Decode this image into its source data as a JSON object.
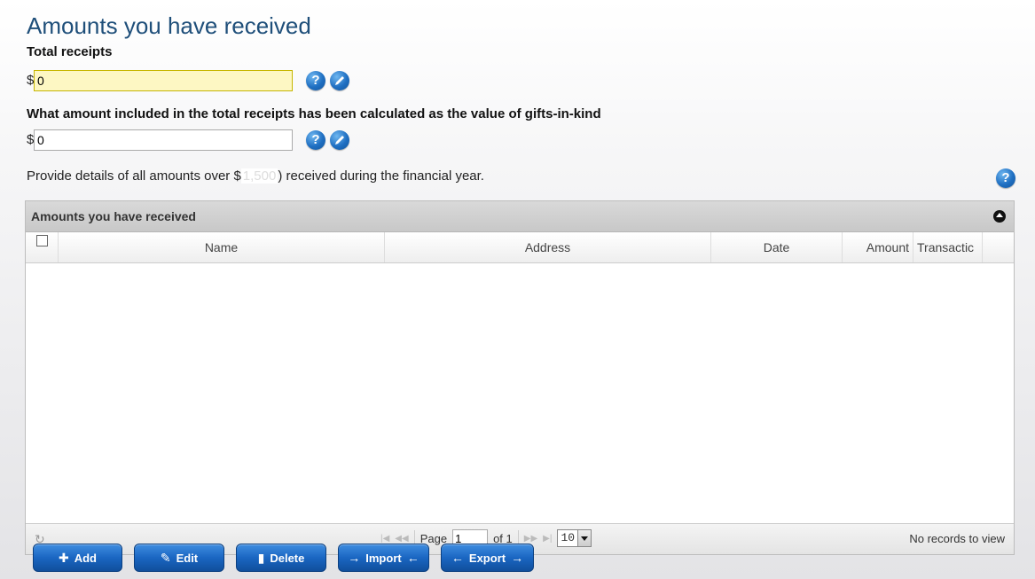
{
  "page": {
    "title": "Amounts you have received"
  },
  "total_receipts": {
    "label": "Total receipts",
    "currency": "$",
    "value": "0"
  },
  "gifts_in_kind": {
    "label": "What amount included in the total receipts has been calculated as the value of gifts-in-kind",
    "currency": "$",
    "value": "0"
  },
  "provide": {
    "prefix": "Provide details of all amounts over $",
    "masked": "1,500",
    "suffix": ") received during the financial year."
  },
  "grid": {
    "caption": "Amounts you have received",
    "columns": {
      "name": "Name",
      "address": "Address",
      "date": "Date",
      "amount": "Amount",
      "transaction": "Transactic"
    },
    "pager": {
      "page_label": "Page",
      "page_value": "1",
      "of_label": "of 1",
      "rows": "10",
      "records_info": "No records to view"
    }
  },
  "actions": {
    "add": "Add",
    "edit": "Edit",
    "delete": "Delete",
    "import": "Import",
    "export": "Export"
  },
  "colors": {
    "title": "#1f4f7a",
    "button": "#1a66c2",
    "active_input": "#fdf7c3"
  }
}
